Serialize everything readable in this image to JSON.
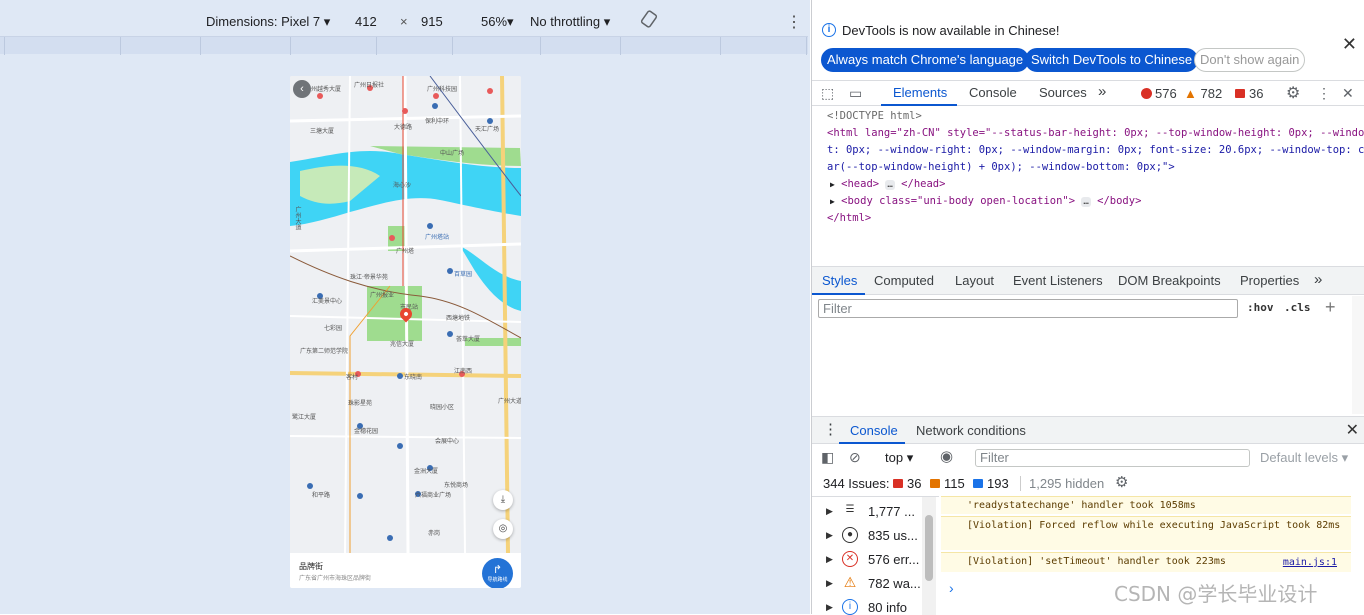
{
  "device_toolbar": {
    "dimensions": "Dimensions: Pixel 7",
    "width": "412",
    "times": "×",
    "height": "915",
    "zoom": "56%",
    "throttling": "No throttling"
  },
  "map": {
    "labels": [
      "广州越秀大厦",
      "广州日报社",
      "广州科技园",
      "三塘大厦",
      "大德路",
      "保利中环",
      "天汇广场",
      "中山广场",
      "海心沙",
      "广州塔",
      "广州塔站",
      "珠江·帝景华苑",
      "广州报业",
      "广州大道",
      "市民站",
      "汇美景中心",
      "百草园",
      "七彩园",
      "广东第二师范学院",
      "西塘地铁",
      "荟萃大厦",
      "兆信大厦",
      "东晓南",
      "珠影星苑",
      "晓园小区",
      "金穗花园",
      "会展中心",
      "鹭江大厦",
      "金洲大厦",
      "东悦商场",
      "六福商业广场",
      "和平路",
      "客村",
      "赤岗",
      "广州大道南",
      "江南西"
    ],
    "back_icon": "chevron-left",
    "download_icon": "download",
    "locate_icon": "crosshair"
  },
  "location": {
    "name": "品牌街",
    "address": "广东省广州市海珠区品牌街",
    "nav_label": "导航路线"
  },
  "devtools": {
    "info_text": "DevTools is now available in Chinese!",
    "btn_match": "Always match Chrome's language",
    "btn_switch": "Switch DevTools to Chinese",
    "btn_dont_show": "Don't show again",
    "tabs": [
      "Elements",
      "Console",
      "Sources"
    ],
    "more_tabs": "»",
    "error_count": "576",
    "warning_count": "782",
    "issue_count": "36",
    "elements": {
      "doctype": "<!DOCTYPE html>",
      "html_open": "<html lang=\"zh-CN\" style=\"--status-bar-height: 0px; --top-window-height: 0px; --window-lef",
      "html_cont1": "t: 0px; --window-right: 0px; --window-margin: 0px; font-size: 20.6px; --window-top: calc(v",
      "html_cont2": "ar(--top-window-height) + 0px); --window-bottom: 0px;\">",
      "head_open": "<head>",
      "head_close": "</head>",
      "body_open": "<body class=\"uni-body open-location\">",
      "body_close": "</body>",
      "html_close": "</html>",
      "ellipsis": "…"
    },
    "styles_tabs": [
      "Styles",
      "Computed",
      "Layout",
      "Event Listeners",
      "DOM Breakpoints",
      "Properties"
    ],
    "styles_more": "»",
    "styles_filter_placeholder": "Filter",
    "hov": ":hov",
    "cls": ".cls",
    "plus": "+",
    "drawer_tabs": [
      "Console",
      "Network conditions"
    ],
    "console": {
      "context": "top",
      "filter_placeholder": "Filter",
      "levels": "Default levels",
      "issues_label": "344 Issues:",
      "issues_errors": "36",
      "issues_warnings": "115",
      "issues_info": "193",
      "hidden": "1,295 hidden",
      "sidebar": [
        {
          "count": "1,777 ...",
          "icon": "list-icon"
        },
        {
          "count": "835 us...",
          "icon": "user-icon"
        },
        {
          "count": "576 err...",
          "icon": "error-icon"
        },
        {
          "count": "782 wa...",
          "icon": "warning-icon"
        },
        {
          "count": "80 info",
          "icon": "info-icon"
        }
      ],
      "messages": [
        {
          "text": "'readystatechange' handler took 1058ms",
          "source": ""
        },
        {
          "text": "[Violation] Forced reflow while executing JavaScript took 82ms",
          "source": ""
        },
        {
          "text": "[Violation] 'setTimeout' handler took 223ms",
          "source": "main.js:1"
        }
      ],
      "prompt": "›"
    }
  },
  "watermark": "CSDN @学长毕业设计",
  "colors": {
    "accent": "#0b57d0",
    "error": "#d93025",
    "warning": "#e37400",
    "water": "#3fd4f5",
    "park": "#9fdc8f"
  }
}
